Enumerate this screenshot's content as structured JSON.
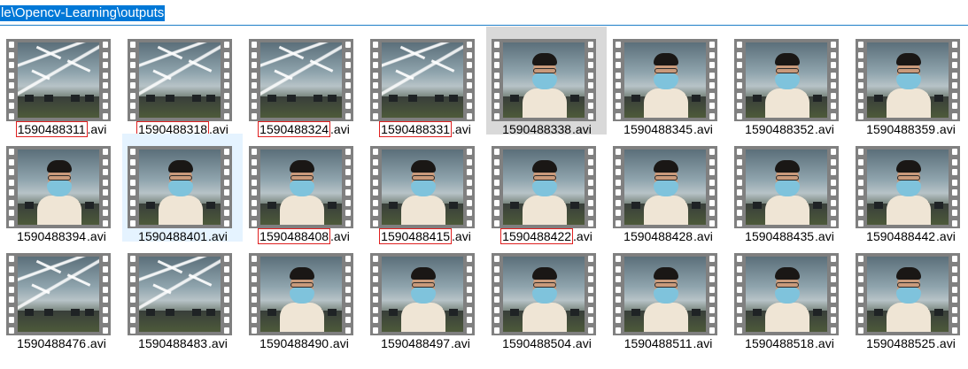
{
  "address_bar": {
    "path_text": "le\\Opencv-Learning\\outputs"
  },
  "files": [
    {
      "stem": "1590488311",
      "ext": ".avi",
      "marked": true,
      "scene": "office",
      "state": ""
    },
    {
      "stem": "1590488318",
      "ext": ".avi",
      "marked": true,
      "scene": "office",
      "state": ""
    },
    {
      "stem": "1590488324",
      "ext": ".avi",
      "marked": true,
      "scene": "office",
      "state": ""
    },
    {
      "stem": "1590488331",
      "ext": ".avi",
      "marked": true,
      "scene": "office",
      "state": ""
    },
    {
      "stem": "1590488338",
      "ext": ".avi",
      "marked": false,
      "scene": "person",
      "state": "selected"
    },
    {
      "stem": "1590488345",
      "ext": ".avi",
      "marked": false,
      "scene": "person",
      "state": ""
    },
    {
      "stem": "1590488352",
      "ext": ".avi",
      "marked": false,
      "scene": "person",
      "state": ""
    },
    {
      "stem": "1590488359",
      "ext": ".avi",
      "marked": false,
      "scene": "person",
      "state": ""
    },
    {
      "stem": "1590488394",
      "ext": ".avi",
      "marked": false,
      "scene": "person",
      "state": ""
    },
    {
      "stem": "1590488401",
      "ext": ".avi",
      "marked": false,
      "scene": "person",
      "state": "hovered"
    },
    {
      "stem": "1590488408",
      "ext": ".avi",
      "marked": true,
      "scene": "person",
      "state": ""
    },
    {
      "stem": "1590488415",
      "ext": ".avi",
      "marked": true,
      "scene": "person",
      "state": ""
    },
    {
      "stem": "1590488422",
      "ext": ".avi",
      "marked": true,
      "scene": "person",
      "state": ""
    },
    {
      "stem": "1590488428",
      "ext": ".avi",
      "marked": false,
      "scene": "person",
      "state": ""
    },
    {
      "stem": "1590488435",
      "ext": ".avi",
      "marked": false,
      "scene": "person",
      "state": ""
    },
    {
      "stem": "1590488442",
      "ext": ".avi",
      "marked": false,
      "scene": "person",
      "state": ""
    },
    {
      "stem": "1590488476",
      "ext": ".avi",
      "marked": false,
      "scene": "office",
      "state": ""
    },
    {
      "stem": "1590488483",
      "ext": ".avi",
      "marked": false,
      "scene": "office",
      "state": ""
    },
    {
      "stem": "1590488490",
      "ext": ".avi",
      "marked": false,
      "scene": "person",
      "state": ""
    },
    {
      "stem": "1590488497",
      "ext": ".avi",
      "marked": false,
      "scene": "person",
      "state": ""
    },
    {
      "stem": "1590488504",
      "ext": ".avi",
      "marked": false,
      "scene": "person",
      "state": ""
    },
    {
      "stem": "1590488511",
      "ext": ".avi",
      "marked": false,
      "scene": "person",
      "state": ""
    },
    {
      "stem": "1590488518",
      "ext": ".avi",
      "marked": false,
      "scene": "person",
      "state": ""
    },
    {
      "stem": "1590488525",
      "ext": ".avi",
      "marked": false,
      "scene": "person",
      "state": ""
    }
  ],
  "icon": "video-file-thumbnail-icon",
  "colors": {
    "selection_highlight": "#0078d7",
    "annotation_box": "#e02020",
    "hover_background": "#e5f3ff",
    "selected_background": "#d9d9d9"
  }
}
